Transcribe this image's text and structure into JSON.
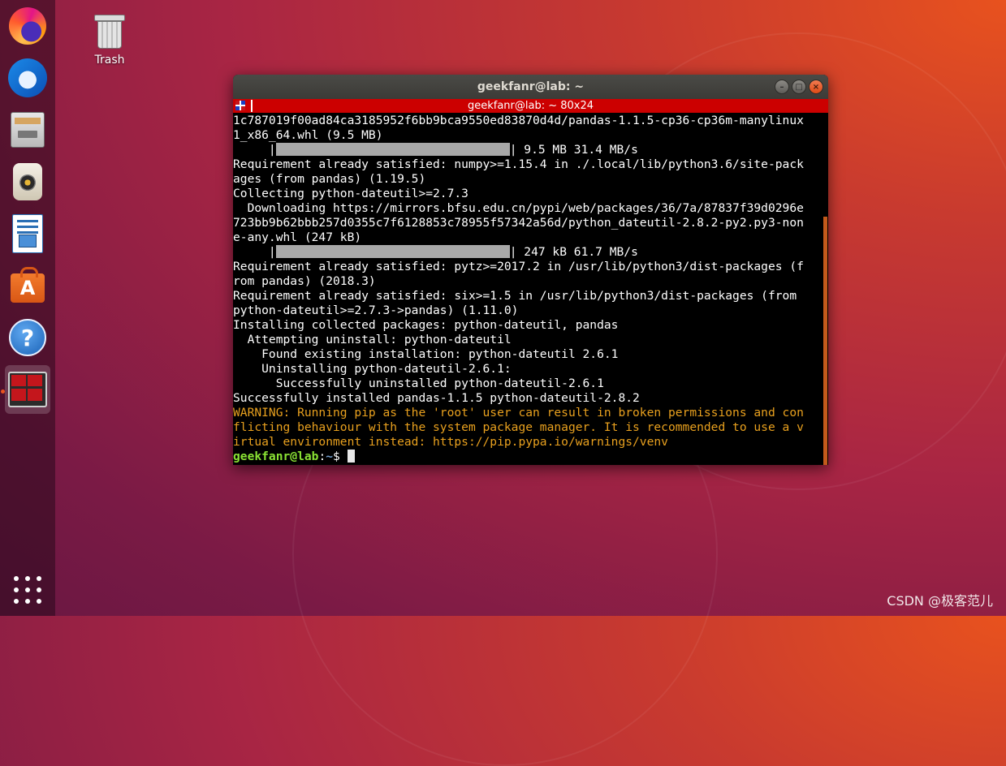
{
  "desktop": {
    "trash_label": "Trash",
    "watermark": "CSDN @极客范儿"
  },
  "dock": {
    "items": [
      {
        "name": "firefox",
        "icon": "firefox-icon"
      },
      {
        "name": "thunderbird",
        "icon": "thunderbird-mail-icon"
      },
      {
        "name": "files",
        "icon": "file-cabinet-icon"
      },
      {
        "name": "rhythmbox",
        "icon": "speaker-icon"
      },
      {
        "name": "libreoffice-writer",
        "icon": "document-icon"
      },
      {
        "name": "ubuntu-software",
        "icon": "shopping-bag-icon",
        "glyph": "A"
      },
      {
        "name": "help",
        "icon": "help-icon",
        "glyph": "?"
      },
      {
        "name": "terminal",
        "icon": "terminal-icon",
        "active": true
      }
    ],
    "show_apps_icon": "grid-dots-icon"
  },
  "window": {
    "title": "geekfanr@lab: ~",
    "tab_title": "geekfanr@lab: ~ 80x24",
    "buttons": {
      "minimize": "–",
      "maximize": "□",
      "close": "×"
    }
  },
  "terminal": {
    "lines": [
      {
        "text": "1c787019f00ad84ca3185952f6bb9bca9550ed83870d4d/pandas-1.1.5-cp36-cp36m-manylinux"
      },
      {
        "text": "1_x86_64.whl (9.5 MB)"
      },
      {
        "bar_prefix": "     |",
        "bar_suffix": "| 9.5 MB 31.4 MB/s",
        "progress": 1.0
      },
      {
        "text": "Requirement already satisfied: numpy>=1.15.4 in ./.local/lib/python3.6/site-pack"
      },
      {
        "text": "ages (from pandas) (1.19.5)"
      },
      {
        "text": "Collecting python-dateutil>=2.7.3"
      },
      {
        "text": "  Downloading https://mirrors.bfsu.edu.cn/pypi/web/packages/36/7a/87837f39d0296e"
      },
      {
        "text": "723bb9b62bbb257d0355c7f6128853c78955f57342a56d/python_dateutil-2.8.2-py2.py3-non"
      },
      {
        "text": "e-any.whl (247 kB)"
      },
      {
        "bar_prefix": "     |",
        "bar_suffix": "| 247 kB 61.7 MB/s",
        "progress": 1.0
      },
      {
        "text": "Requirement already satisfied: pytz>=2017.2 in /usr/lib/python3/dist-packages (f"
      },
      {
        "text": "rom pandas) (2018.3)"
      },
      {
        "text": "Requirement already satisfied: six>=1.5 in /usr/lib/python3/dist-packages (from"
      },
      {
        "text": "python-dateutil>=2.7.3->pandas) (1.11.0)"
      },
      {
        "text": "Installing collected packages: python-dateutil, pandas"
      },
      {
        "text": "  Attempting uninstall: python-dateutil"
      },
      {
        "text": "    Found existing installation: python-dateutil 2.6.1"
      },
      {
        "text": "    Uninstalling python-dateutil-2.6.1:"
      },
      {
        "text": "      Successfully uninstalled python-dateutil-2.6.1"
      },
      {
        "text": "Successfully installed pandas-1.1.5 python-dateutil-2.8.2"
      },
      {
        "text": "WARNING: Running pip as the 'root' user can result in broken permissions and con",
        "warn": true
      },
      {
        "text": "flicting behaviour with the system package manager. It is recommended to use a v",
        "warn": true
      },
      {
        "text": "irtual environment instead: https://pip.pypa.io/warnings/venv",
        "warn": true
      }
    ],
    "prompt": {
      "user": "geekfanr@lab",
      "sep": ":",
      "path": "~",
      "symbol": "$ "
    }
  },
  "colors": {
    "accent": "#e95420",
    "tab_bar": "#cc0000",
    "warning_text": "#e8a01e",
    "prompt_user": "#8ae234",
    "prompt_path": "#729fcf"
  }
}
